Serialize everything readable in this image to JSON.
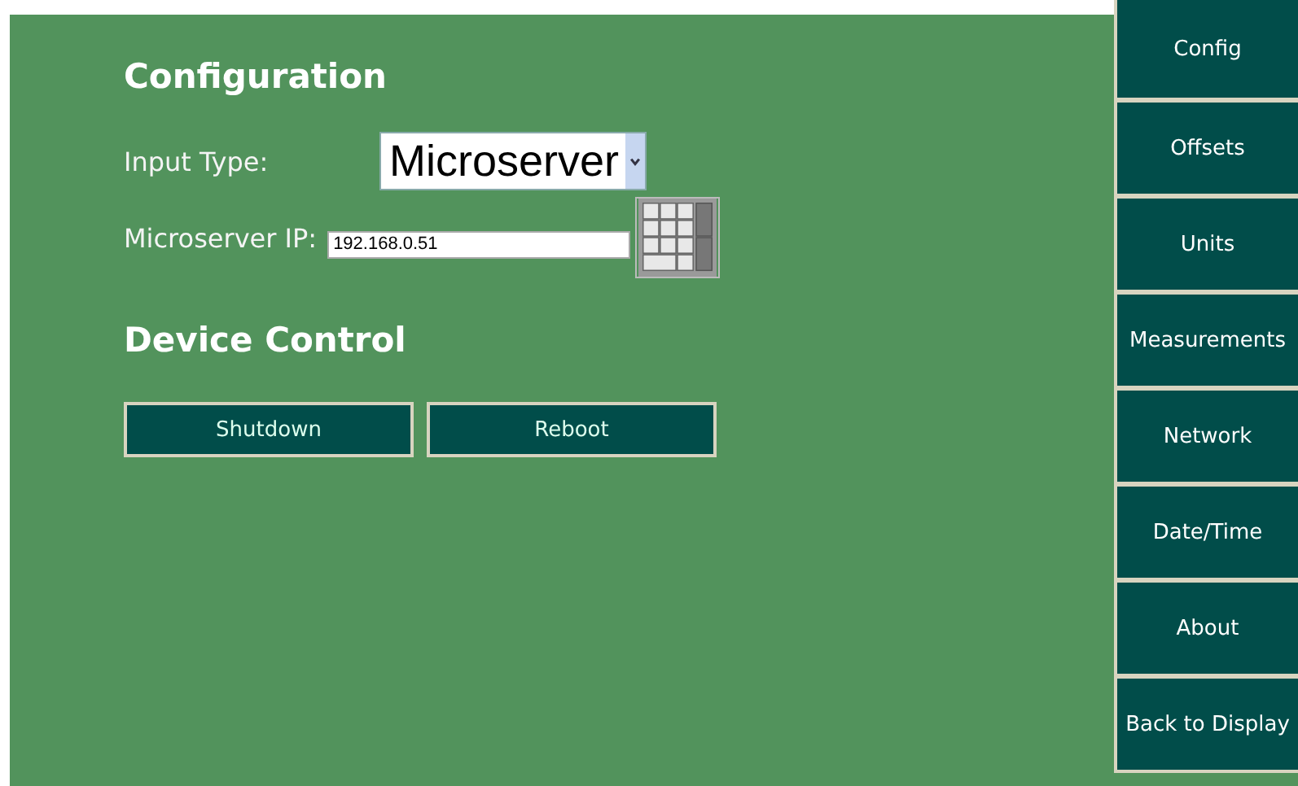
{
  "configuration": {
    "title": "Configuration",
    "input_type": {
      "label": "Input Type:",
      "value": "Microserver"
    },
    "microserver_ip": {
      "label": "Microserver IP:",
      "value": "192.168.0.51"
    }
  },
  "device_control": {
    "title": "Device Control",
    "buttons": [
      "Shutdown",
      "Reboot"
    ]
  },
  "nav": [
    {
      "label": "Config"
    },
    {
      "label": "Offsets"
    },
    {
      "label": "Units"
    },
    {
      "label": "Measurements"
    },
    {
      "label": "Network"
    },
    {
      "label": "Date/Time"
    },
    {
      "label": "About"
    },
    {
      "label": "Back to Display"
    }
  ]
}
